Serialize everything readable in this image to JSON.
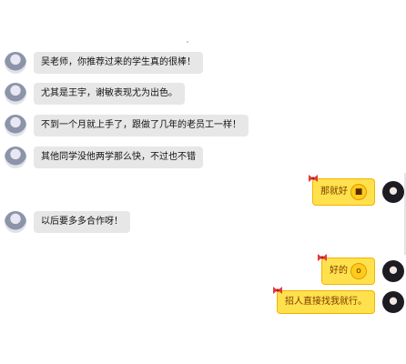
{
  "messages": [
    {
      "side": "left",
      "text": "吴老师，你推荐过来的学生真的很棒！"
    },
    {
      "side": "left",
      "text": "尤其是王宇，谢敏表现尤为出色。"
    },
    {
      "side": "left",
      "text": "不到一个月就上手了，跟做了几年的老员工一样！"
    },
    {
      "side": "left",
      "text": "其他同学没他两学那么快，不过也不错"
    },
    {
      "side": "right",
      "text": "那就好",
      "emoji": "sunglasses-emoji"
    },
    {
      "side": "left",
      "text": "以后要多多合作呀！"
    },
    {
      "side": "right",
      "text": "好的",
      "emoji": "surprised-emoji"
    },
    {
      "side": "right",
      "text": "招人直接找我就行。",
      "emoji": ""
    }
  ],
  "colors": {
    "left_bubble": "#e7e7e7",
    "right_bubble": "#ffe14d",
    "right_text": "#7a3b00"
  }
}
